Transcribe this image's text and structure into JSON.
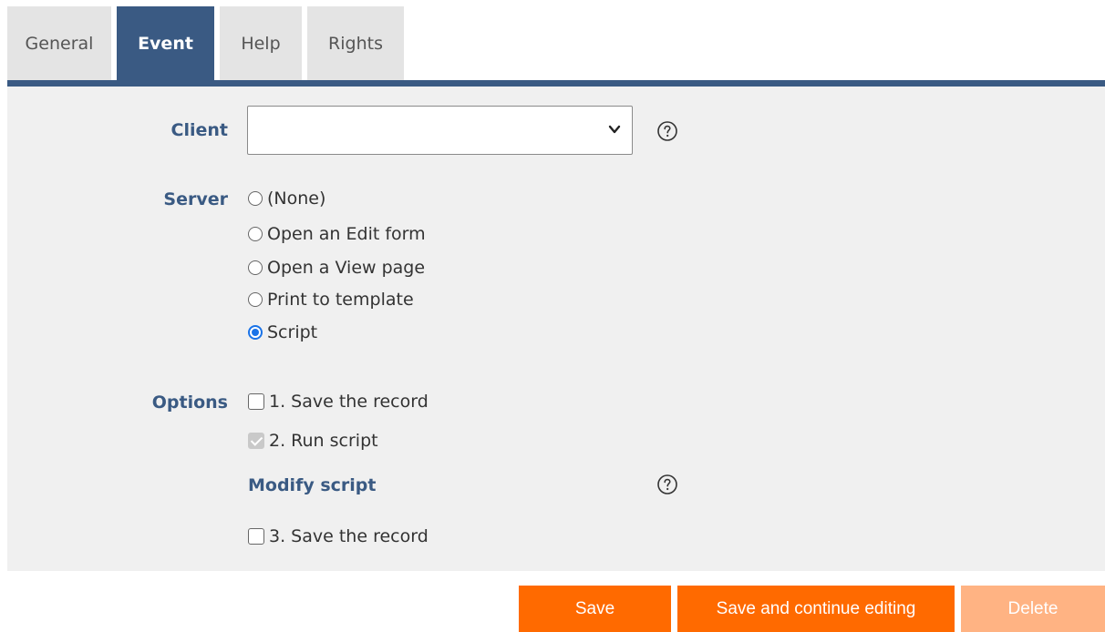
{
  "tabs": [
    {
      "label": "General",
      "active": false
    },
    {
      "label": "Event",
      "active": true
    },
    {
      "label": "Help",
      "active": false
    },
    {
      "label": "Rights",
      "active": false
    }
  ],
  "form": {
    "client": {
      "label": "Client",
      "value": ""
    },
    "server": {
      "label": "Server",
      "options": [
        "(None)",
        "Open an Edit form",
        "Open a View page",
        "Print to template",
        "Script"
      ],
      "selected": "Script"
    },
    "options": {
      "label": "Options",
      "items": [
        {
          "label": "1. Save the record",
          "checked": false,
          "disabled": false
        },
        {
          "label": "2. Run script",
          "checked": true,
          "disabled": true
        }
      ],
      "modify_script_label": "Modify script",
      "after": {
        "label": "3. Save the record",
        "checked": false,
        "disabled": false
      }
    }
  },
  "buttons": {
    "save": "Save",
    "save_continue": "Save and continue editing",
    "delete": "Delete"
  },
  "colors": {
    "tab_active": "#3a5a83",
    "accent": "#ff6a00",
    "accent_disabled": "#ffb383",
    "label": "#3a5a83"
  }
}
